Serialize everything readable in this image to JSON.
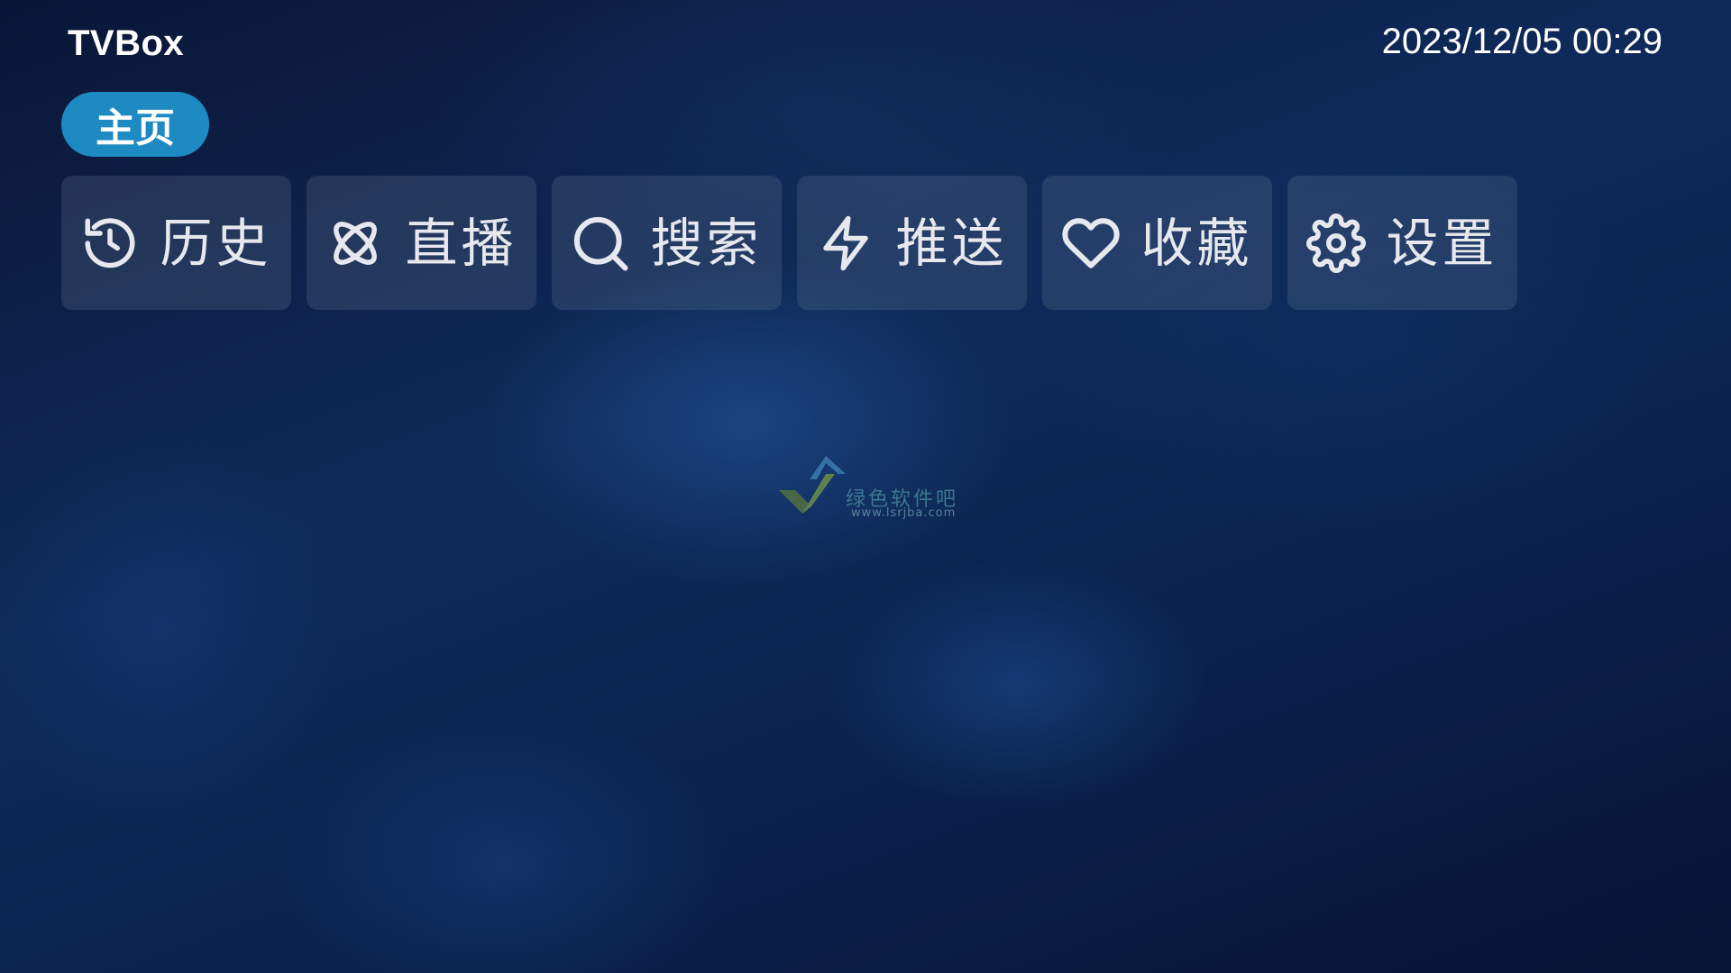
{
  "app": {
    "title": "TVBox",
    "datetime": "2023/12/05 00:29"
  },
  "tabs": [
    {
      "label": "主页",
      "active": true
    }
  ],
  "nav": [
    {
      "label": "历史",
      "icon": "history-icon"
    },
    {
      "label": "直播",
      "icon": "live-icon"
    },
    {
      "label": "搜索",
      "icon": "search-icon"
    },
    {
      "label": "推送",
      "icon": "push-icon"
    },
    {
      "label": "收藏",
      "icon": "heart-icon"
    },
    {
      "label": "设置",
      "icon": "gear-icon"
    }
  ],
  "watermark": {
    "text": "绿色软件吧",
    "url": "www.lsrjba.com"
  },
  "colors": {
    "accent": "#1e8ac2",
    "background_dark": "#0a1636",
    "button_bg": "rgba(120,135,160,0.22)",
    "text": "#ffffff"
  }
}
